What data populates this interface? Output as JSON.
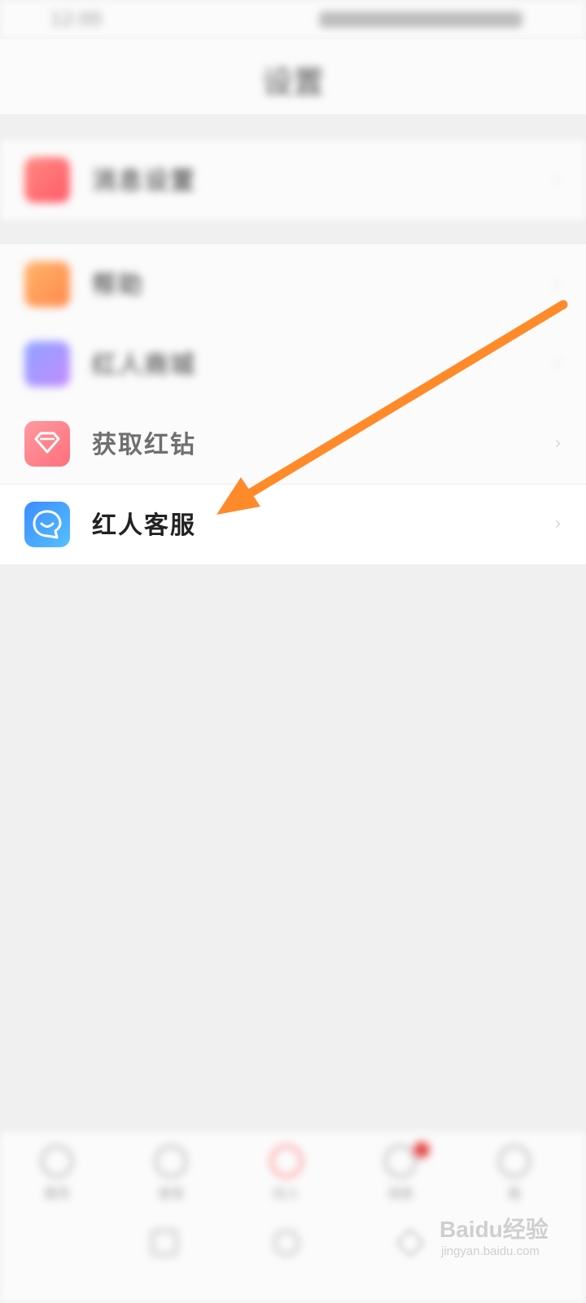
{
  "status_bar": {
    "time": "12:00"
  },
  "header": {
    "title": "设置"
  },
  "section_1": {
    "items": [
      {
        "label": "消息设置",
        "icon": "settings-icon",
        "color": "#ff6f78"
      }
    ]
  },
  "section_2": {
    "items": [
      {
        "label": "帮助",
        "icon": "help-icon",
        "color": "#ff9f5c"
      },
      {
        "label": "红人商城",
        "icon": "shop-icon",
        "color": "#a98bff"
      },
      {
        "label": "获取红钻",
        "icon": "diamond-icon",
        "color": "#ff7e88"
      },
      {
        "label": "红人客服",
        "icon": "customer-service-icon",
        "color": "#3f9dff"
      }
    ]
  },
  "bottom_nav": {
    "items": [
      {
        "label": "首页",
        "icon": "home-icon"
      },
      {
        "label": "发现",
        "icon": "discover-icon"
      },
      {
        "label": "红人",
        "icon": "center-icon"
      },
      {
        "label": "消息",
        "icon": "message-icon"
      },
      {
        "label": "我",
        "icon": "profile-icon"
      }
    ]
  },
  "watermark": {
    "text": "Baidu经验",
    "url": "jingyan.baidu.com"
  },
  "colors": {
    "arrow": "#ff8a2a",
    "accent_blue": "#3f9dff"
  }
}
